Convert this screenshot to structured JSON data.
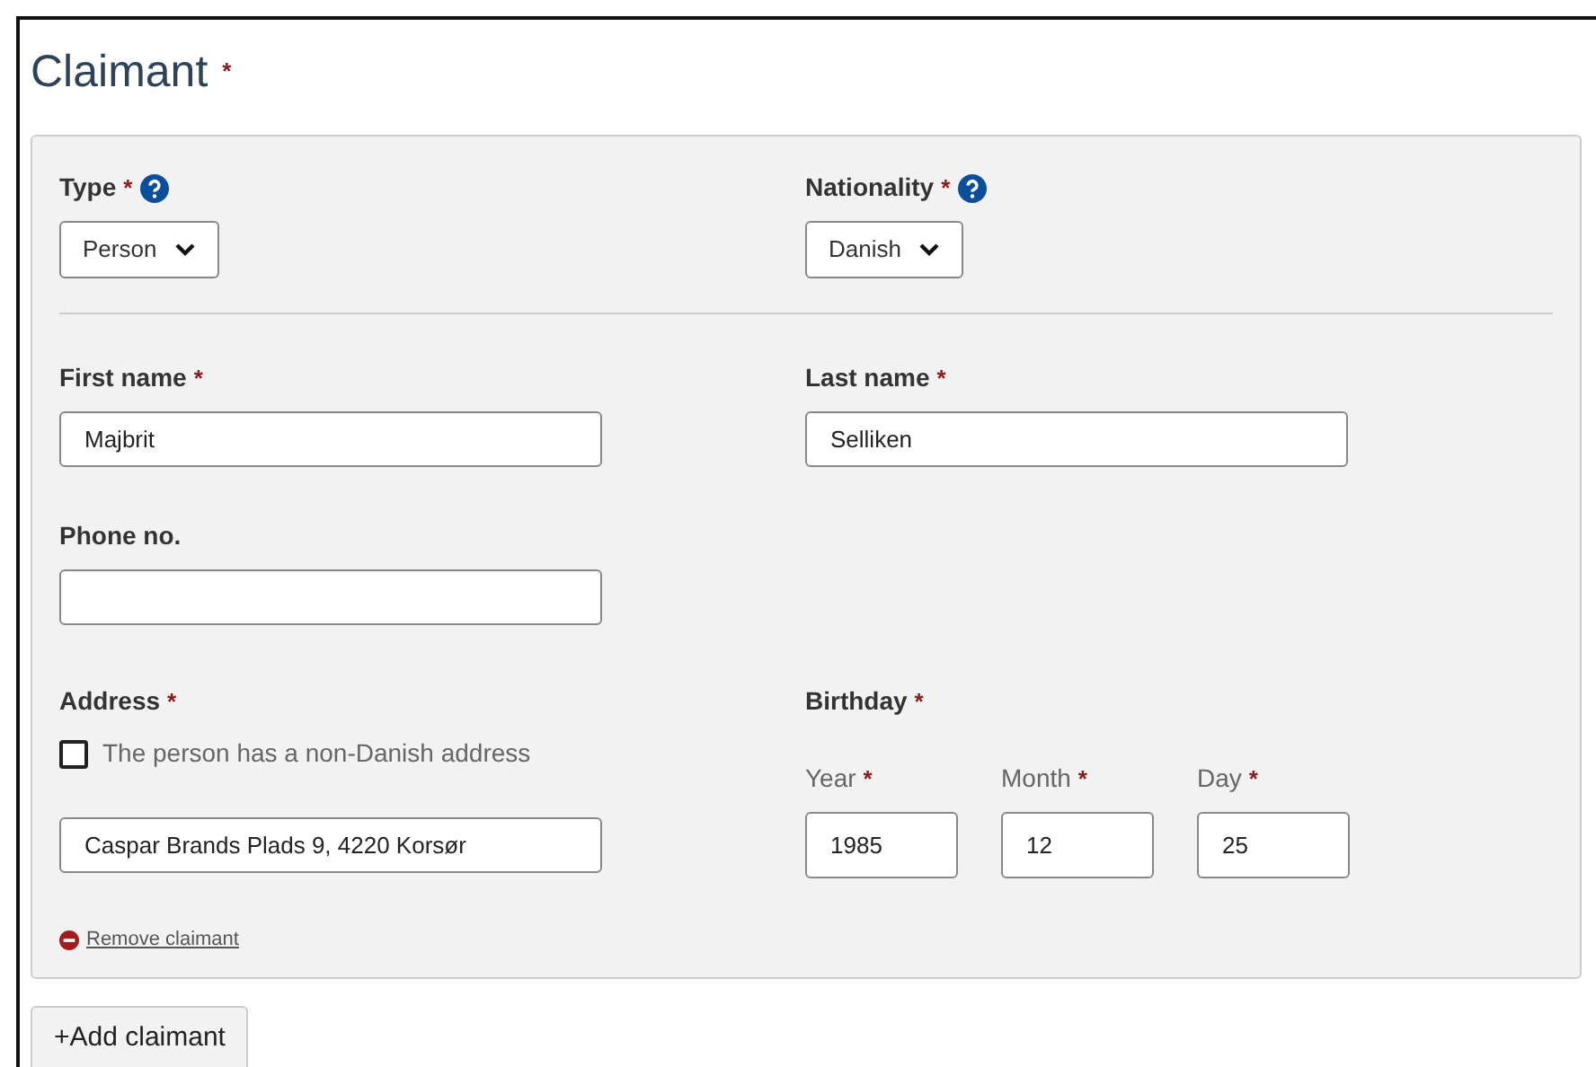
{
  "heading": {
    "text": "Claimant",
    "required_mark": "*"
  },
  "selects": [
    {
      "label": "Type",
      "required_mark": "*",
      "help": true,
      "value": "Person"
    },
    {
      "label": "Nationality",
      "required_mark": "*",
      "help": true,
      "value": "Danish"
    }
  ],
  "name_fields": [
    {
      "label": "First name",
      "required_mark": "*",
      "value": "Majbrit"
    },
    {
      "label": "Last name",
      "required_mark": "*",
      "value": "Selliken"
    }
  ],
  "phone_field": {
    "label": "Phone no."
  },
  "address": {
    "label": "Address",
    "required_mark": "*",
    "checkbox": {
      "label": "The person has a non-Danish address",
      "checked": false
    },
    "value": "Caspar Brands Plads 9, 4220 Korsør"
  },
  "birthday": {
    "label": "Birthday",
    "required_mark": "*",
    "parts": [
      {
        "label": "Year",
        "required_mark": "*",
        "value": "1985"
      },
      {
        "label": "Month",
        "required_mark": "*",
        "value": "12"
      },
      {
        "label": "Day",
        "required_mark": "*",
        "value": "25"
      }
    ]
  },
  "remove_link": "Remove claimant",
  "add_button": "+Add claimant"
}
